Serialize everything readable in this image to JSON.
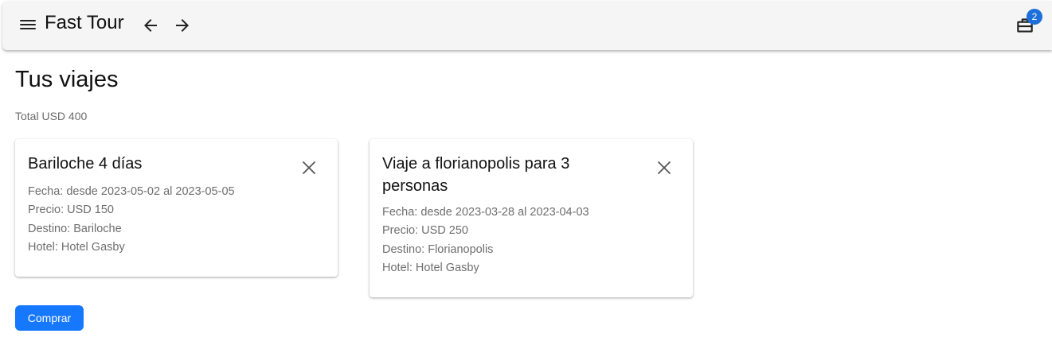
{
  "header": {
    "brand": "Fast Tour",
    "cart_count": "2",
    "icons": [
      "menu-icon",
      "arrow-left-icon",
      "arrow-right-icon",
      "briefcase-icon"
    ]
  },
  "page": {
    "title": "Tus viajes",
    "total": "Total USD 400"
  },
  "trips": [
    {
      "title": "Bariloche 4 días",
      "fecha": "Fecha: desde 2023-05-02 al 2023-05-05",
      "precio": "Precio: USD 150",
      "destino": "Destino: Bariloche",
      "hotel": "Hotel: Hotel Gasby"
    },
    {
      "title_line1": "Viaje a florianopolis para 3",
      "title_line2": "personas",
      "fecha": "Fecha: desde 2023-03-28 al 2023-04-03",
      "precio": "Precio: USD 250",
      "destino": "Destino: Florianopolis",
      "hotel": "Hotel: Hotel Gasby"
    }
  ],
  "actions": {
    "buy_label": "Comprar"
  },
  "colors": {
    "primary": "#1677ff",
    "badge": "#1e6fd9",
    "appbar": "#f5f5f5"
  }
}
